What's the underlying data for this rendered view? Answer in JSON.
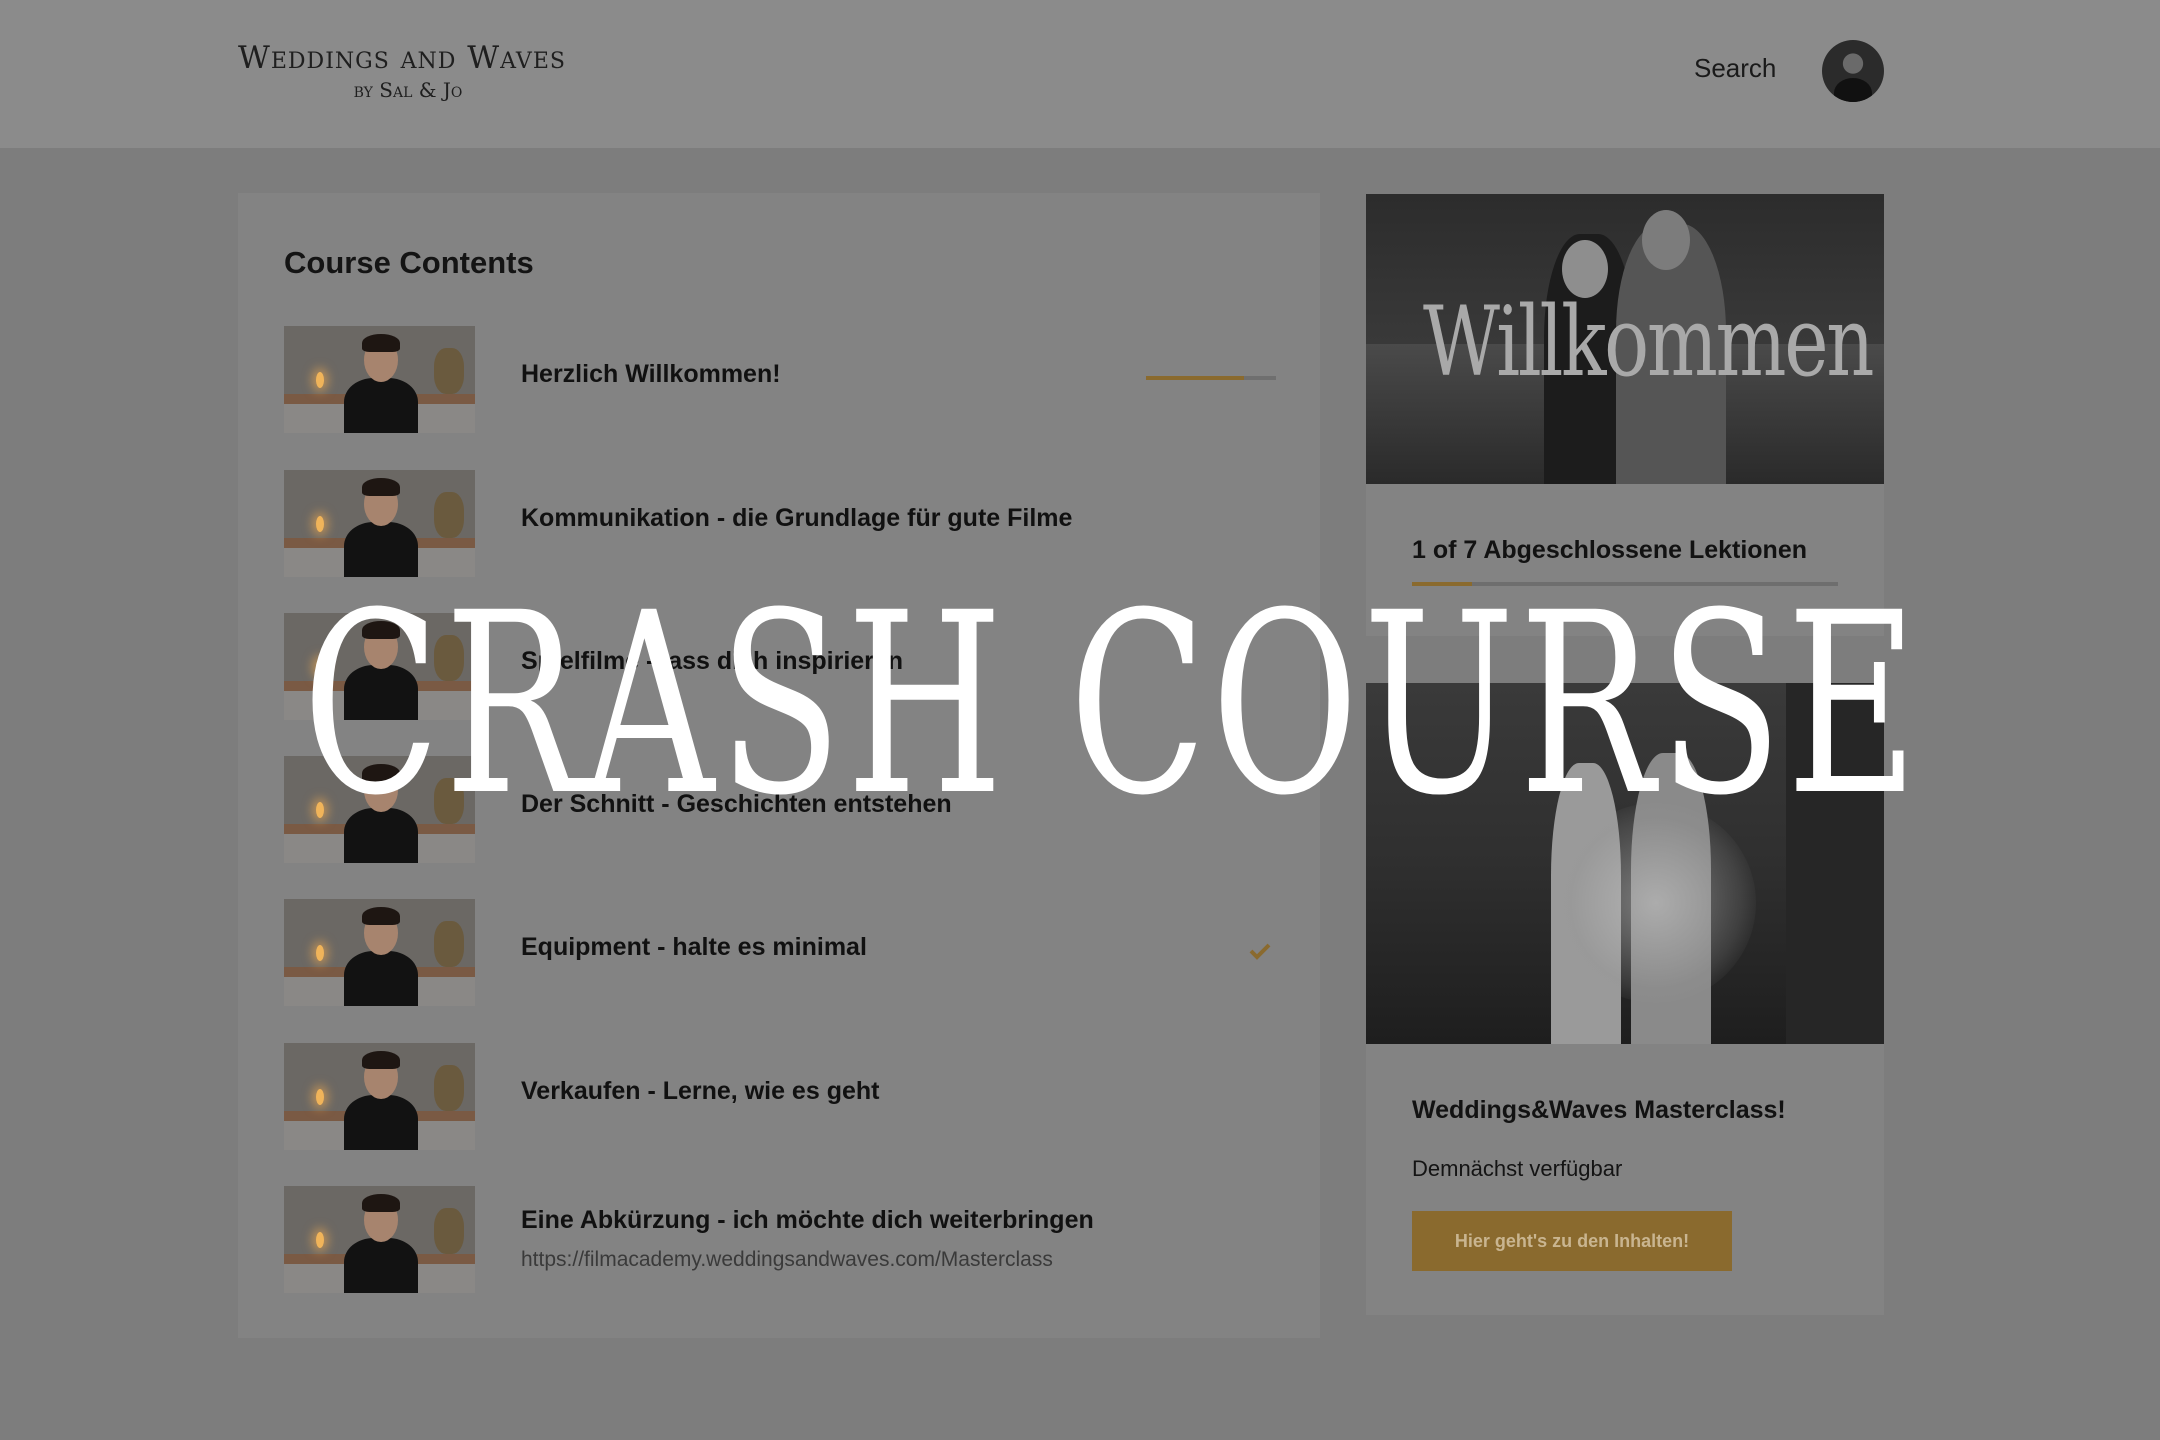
{
  "header": {
    "logo_main": "Weddings and Waves",
    "logo_sub": "by Sal & Jo",
    "search_label": "Search"
  },
  "course": {
    "title": "Course Contents",
    "lessons": [
      {
        "title": "Herzlich Willkommen!",
        "progress": 0.75
      },
      {
        "title": "Kommunikation - die Grundlage für gute Filme"
      },
      {
        "title": "Spielfilme - lass dich inspirieren"
      },
      {
        "title": "Der Schnitt - Geschichten entstehen"
      },
      {
        "title": "Equipment - halte es minimal",
        "completed": true
      },
      {
        "title": "Verkaufen - Lerne, wie es geht"
      },
      {
        "title": "Eine Abkürzung - ich möchte dich weiterbringen",
        "subtitle": "https://filmacademy.weddingsandwaves.com/Masterclass"
      }
    ]
  },
  "sidebar": {
    "welcome_text": "Willkommen",
    "progress_text": "1 of 7 Abgeschlossene Lektionen",
    "progress_fraction": 0.142,
    "master_title": "Weddings&Waves Masterclass!",
    "master_subtitle": "Demnächst verfügbar",
    "cta_label": "Hier geht's zu den Inhalten!"
  },
  "overlay": {
    "title": "CRASH COURSE"
  },
  "colors": {
    "accent": "#8a6a2e",
    "background": "#7d7d7d",
    "card": "#838383"
  }
}
